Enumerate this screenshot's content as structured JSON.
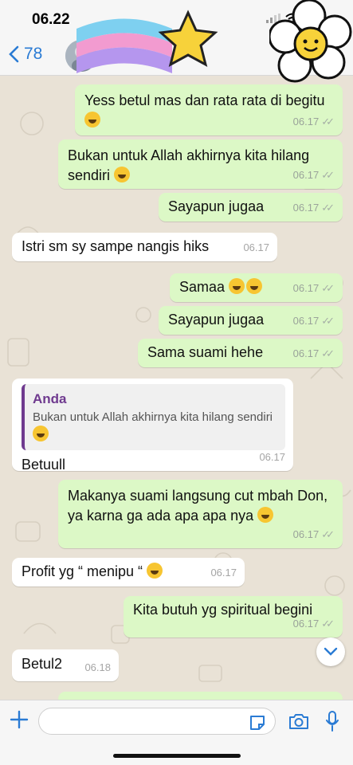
{
  "status_bar": {
    "time": "06.22"
  },
  "header": {
    "back_count": "78"
  },
  "messages": [
    {
      "dir": "out",
      "text": "Yess betul mas dan rata rata di begitu",
      "time": "06.17"
    },
    {
      "dir": "out",
      "text": "Bukan untuk Allah akhirnya kita hilang sendiri",
      "time": "06.17"
    },
    {
      "dir": "out",
      "text": "Sayapun jugaa",
      "time": "06.17"
    },
    {
      "dir": "in",
      "text": "Istri sm sy sampe nangis hiks",
      "time": "06.17"
    },
    {
      "dir": "out",
      "text": "Samaa",
      "time": "06.17"
    },
    {
      "dir": "out",
      "text": "Sayapun jugaa",
      "time": "06.17"
    },
    {
      "dir": "out",
      "text": "Sama suami hehe",
      "time": "06.17"
    },
    {
      "dir": "in",
      "reply_name": "Anda",
      "reply_text": "Bukan untuk Allah akhirnya kita hilang sendiri",
      "text": "Betuull",
      "time": "06.17"
    },
    {
      "dir": "out",
      "text": "Makanya suami langsung cut mbah Don, ya karna ga ada apa apa nya",
      "time": "06.17"
    },
    {
      "dir": "in",
      "text": "Profit yg “ menipu “",
      "time": "06.17"
    },
    {
      "dir": "out",
      "text": "Kita butuh yg spiritual begini",
      "time": "06.17"
    },
    {
      "dir": "in",
      "text": "Betul2",
      "time": "06.18"
    }
  ],
  "input": {
    "placeholder": ""
  },
  "icons": {
    "back": "chevron-left-icon",
    "plus": "plus-icon",
    "sticker": "sticker-icon",
    "camera": "camera-icon",
    "mic": "microphone-icon",
    "scroll": "chevron-down-icon"
  },
  "colors": {
    "outgoing_bubble": "#dcf8c6",
    "incoming_bubble": "#ffffff",
    "accent": "#2a7bd4",
    "reply_accent": "#6f3a8f"
  }
}
